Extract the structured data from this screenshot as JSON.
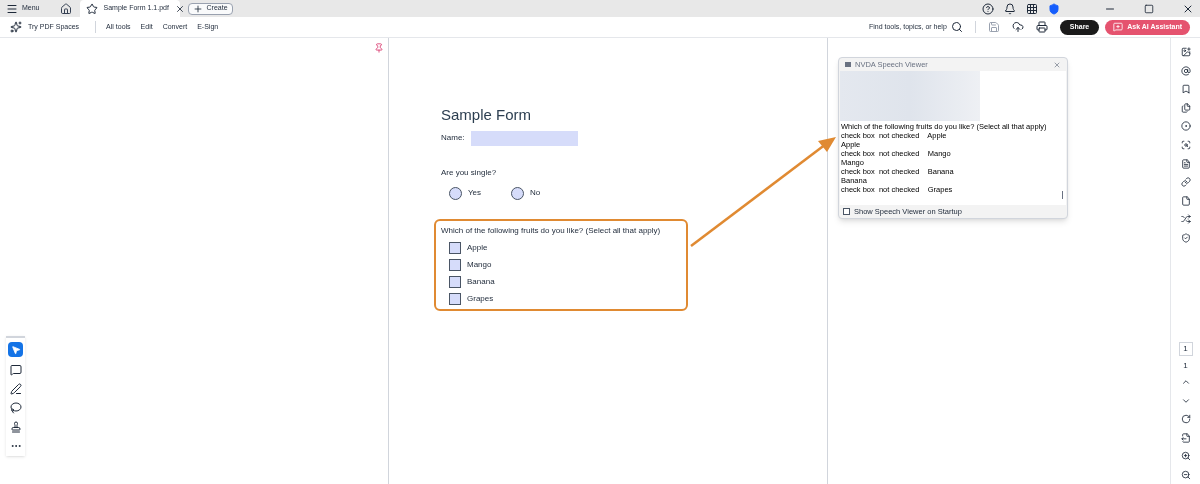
{
  "top_bar": {
    "menu": "Menu",
    "tab": "Sample Form 1.1.pdf",
    "create": "Create"
  },
  "toolbar": {
    "spaces": "Try PDF Spaces",
    "items": [
      "All tools",
      "Edit",
      "Convert",
      "E-Sign"
    ],
    "search": "Find tools, topics, or help",
    "share": "Share",
    "ai": "Ask AI Assistant"
  },
  "form": {
    "title": "Sample Form",
    "name_label": "Name:",
    "single_question": "Are you single?",
    "radios": [
      {
        "label": "Yes",
        "selected": false
      },
      {
        "label": "No",
        "selected": false
      }
    ],
    "fruits_question": "Which of the following fruits do you like? (Select all that apply)",
    "checkboxes": [
      {
        "label": "Apple",
        "checked": false
      },
      {
        "label": "Mango",
        "checked": false
      },
      {
        "label": "Banana",
        "checked": false
      },
      {
        "label": "Grapes",
        "checked": false
      }
    ]
  },
  "speech_viewer": {
    "title": "NVDA Speech Viewer",
    "lines": [
      "Which of the following fruits do you like? (Select all that apply)",
      "check box  not checked    Apple",
      "Apple",
      "check box  not checked    Mango",
      "Mango",
      "check box  not checked    Banana",
      "Banana",
      "check box  not checked    Grapes"
    ],
    "startup_label": "Show Speech Viewer on Startup",
    "startup_checked": false
  },
  "page_nav": {
    "current": "1",
    "total": "1"
  }
}
